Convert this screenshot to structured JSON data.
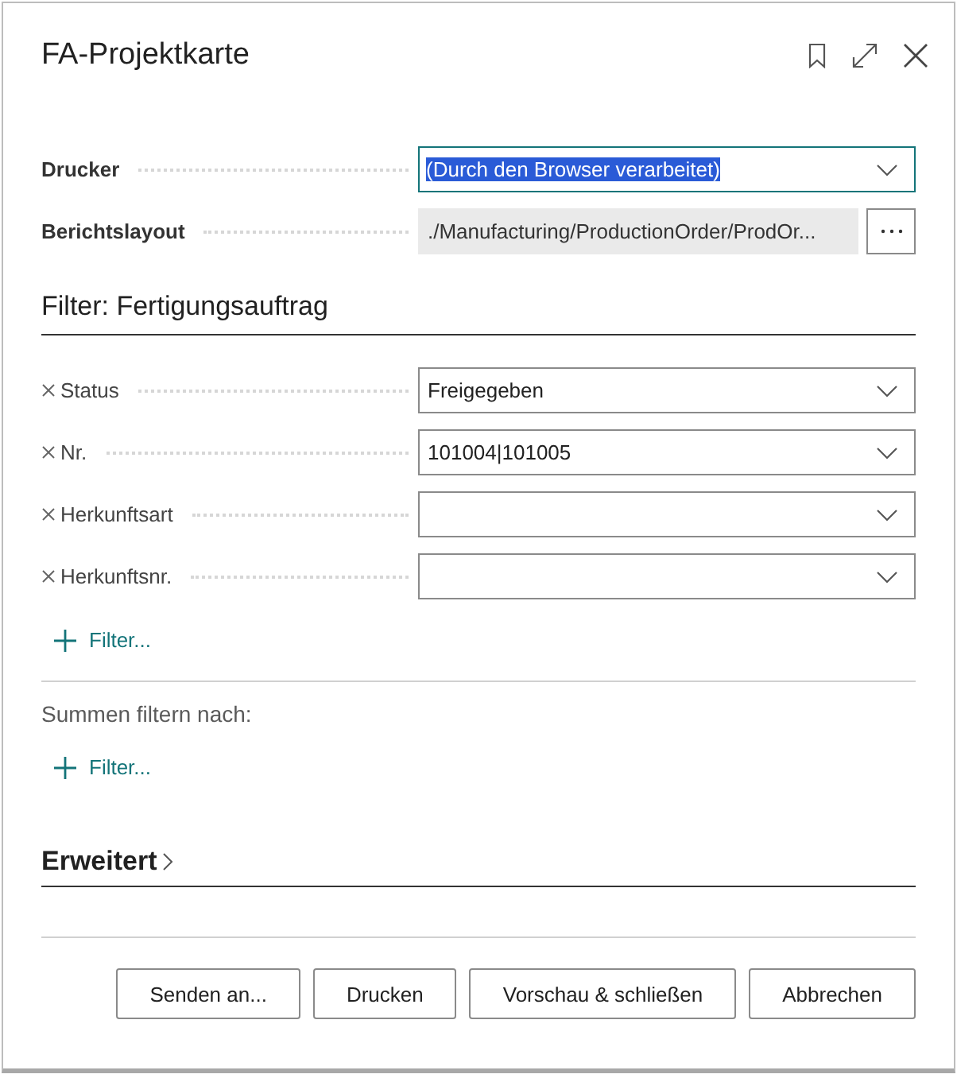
{
  "dialog": {
    "title": "FA-Projektkarte"
  },
  "options": [
    {
      "label": "Drucker",
      "kind": "dropdown",
      "value": "(Durch den Browser verarbeitet)",
      "highlighted": true
    },
    {
      "label": "Berichtslayout",
      "kind": "lookup",
      "value": "./Manufacturing/ProductionOrder/ProdOr..."
    }
  ],
  "filter_section": {
    "title": "Filter: Fertigungsauftrag",
    "filters": [
      {
        "label": "Status",
        "value": "Freigegeben"
      },
      {
        "label": "Nr.",
        "value": "101004|101005"
      },
      {
        "label": "Herkunftsart"
      },
      {
        "label": "Herkunftsnr."
      }
    ],
    "add_filter": "Filter..."
  },
  "totals_section": {
    "title": "Summen filtern nach:",
    "add_filter": "Filter..."
  },
  "advanced_section": {
    "title": "Erweitert",
    "expanded": false
  },
  "buttons": [
    "Senden an...",
    "Drucken",
    "Vorschau & schließen",
    "Abbrechen"
  ]
}
